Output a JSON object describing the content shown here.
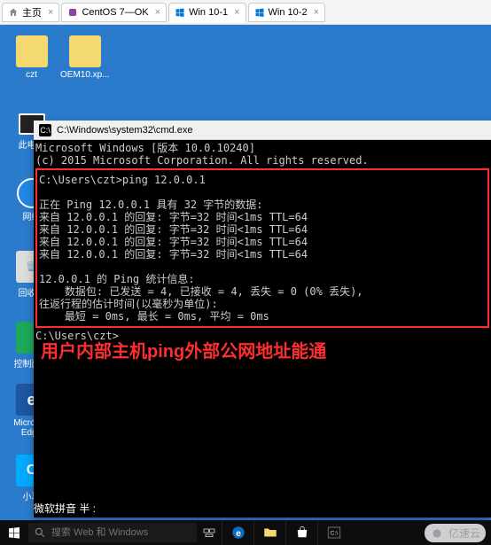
{
  "tabs": [
    {
      "icon": "home",
      "label": "主页"
    },
    {
      "icon": "linux",
      "label": "CentOS 7—OK"
    },
    {
      "icon": "win",
      "label": "Win 10-1",
      "active": true
    },
    {
      "icon": "win",
      "label": "Win 10-2"
    }
  ],
  "desktop_icons": {
    "czt": "czt",
    "oem": "OEM10.xp...",
    "pc": "此电脑",
    "net": "网络",
    "recycle": "回收站",
    "ctrl": "控制面板",
    "edge_1": "Microsoft",
    "edge_2": "Edge",
    "xm": "小马"
  },
  "cmd": {
    "title": "C:\\Windows\\system32\\cmd.exe",
    "header_1": "Microsoft Windows [版本 10.0.10240]",
    "header_2": "(c) 2015 Microsoft Corporation. All rights reserved.",
    "prompt_cmd": "C:\\Users\\czt>ping 12.0.0.1",
    "ping_intro": "正在 Ping 12.0.0.1 具有 32 字节的数据:",
    "reply_1": "来自 12.0.0.1 的回复: 字节=32 时间<1ms TTL=64",
    "reply_2": "来自 12.0.0.1 的回复: 字节=32 时间<1ms TTL=64",
    "reply_3": "来自 12.0.0.1 的回复: 字节=32 时间<1ms TTL=64",
    "reply_4": "来自 12.0.0.1 的回复: 字节=32 时间<1ms TTL=64",
    "stats_title": "12.0.0.1 的 Ping 统计信息:",
    "stats_pkts": "    数据包: 已发送 = 4, 已接收 = 4, 丢失 = 0 (0% 丢失),",
    "stats_rtt_label": "往返行程的估计时间(以毫秒为单位):",
    "stats_rtt": "    最短 = 0ms, 最长 = 0ms, 平均 = 0ms",
    "prompt_after": "C:\\Users\\czt>",
    "annotation": "用户内部主机ping外部公网地址能通"
  },
  "ime": "微软拼音 半 :",
  "taskbar": {
    "search_placeholder": "搜索 Web 和 Windows"
  },
  "watermark": "亿速云"
}
